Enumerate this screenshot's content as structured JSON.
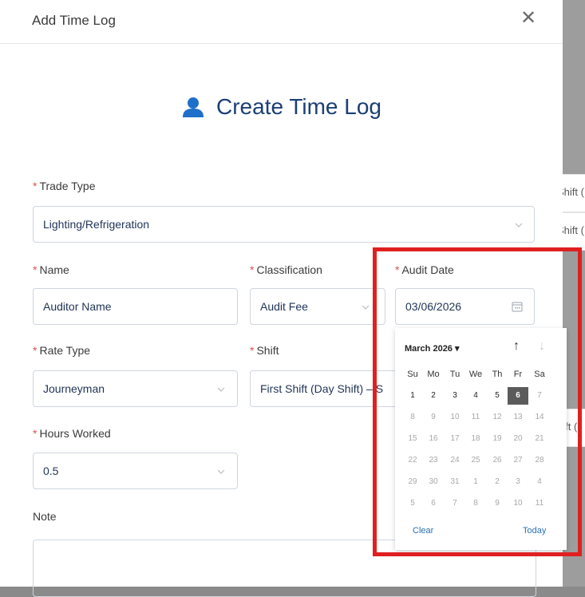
{
  "modal": {
    "title": "Add Time Log"
  },
  "heading": "Create Time Log",
  "background_rows": [
    "Shift (",
    "Shift (",
    "hift ("
  ],
  "fields": {
    "trade_type": {
      "label": "Trade Type",
      "value": "Lighting/Refrigeration"
    },
    "name": {
      "label": "Name",
      "value": "Auditor Name"
    },
    "classification": {
      "label": "Classification",
      "value": "Audit Fee"
    },
    "audit_date": {
      "label": "Audit Date",
      "value": "03/06/2026"
    },
    "rate_type": {
      "label": "Rate Type",
      "value": "Journeyman"
    },
    "shift": {
      "label": "Shift",
      "value": "First Shift (Day Shift) – S"
    },
    "hours_worked": {
      "label": "Hours Worked",
      "value": "0.5"
    },
    "note": {
      "label": "Note"
    }
  },
  "required_mark": "*",
  "calendar": {
    "month_label": "March 2026",
    "weekdays": [
      "Su",
      "Mo",
      "Tu",
      "We",
      "Th",
      "Fr",
      "Sa"
    ],
    "days": [
      [
        [
          "1",
          "cur"
        ],
        [
          "2",
          "cur"
        ],
        [
          "3",
          "cur"
        ],
        [
          "4",
          "cur"
        ],
        [
          "5",
          "cur"
        ],
        [
          "6",
          "sel"
        ],
        [
          "7",
          "other"
        ]
      ],
      [
        [
          "8",
          "other"
        ],
        [
          "9",
          "other"
        ],
        [
          "10",
          "other"
        ],
        [
          "11",
          "other"
        ],
        [
          "12",
          "other"
        ],
        [
          "13",
          "other"
        ],
        [
          "14",
          "other"
        ]
      ],
      [
        [
          "15",
          "other"
        ],
        [
          "16",
          "other"
        ],
        [
          "17",
          "other"
        ],
        [
          "18",
          "other"
        ],
        [
          "19",
          "other"
        ],
        [
          "20",
          "other"
        ],
        [
          "21",
          "other"
        ]
      ],
      [
        [
          "22",
          "other"
        ],
        [
          "23",
          "other"
        ],
        [
          "24",
          "other"
        ],
        [
          "25",
          "other"
        ],
        [
          "26",
          "other"
        ],
        [
          "27",
          "other"
        ],
        [
          "28",
          "other"
        ]
      ],
      [
        [
          "29",
          "other"
        ],
        [
          "30",
          "other"
        ],
        [
          "31",
          "other"
        ],
        [
          "1",
          "other"
        ],
        [
          "2",
          "other"
        ],
        [
          "3",
          "other"
        ],
        [
          "4",
          "other"
        ]
      ],
      [
        [
          "5",
          "other"
        ],
        [
          "6",
          "other"
        ],
        [
          "7",
          "other"
        ],
        [
          "8",
          "other"
        ],
        [
          "9",
          "other"
        ],
        [
          "10",
          "other"
        ],
        [
          "11",
          "other"
        ]
      ]
    ],
    "clear_label": "Clear",
    "today_label": "Today"
  },
  "colors": {
    "accent": "#1b3f73",
    "highlight": "#e02020",
    "link": "#2a6fb5",
    "icon": "#1e6fc9"
  }
}
